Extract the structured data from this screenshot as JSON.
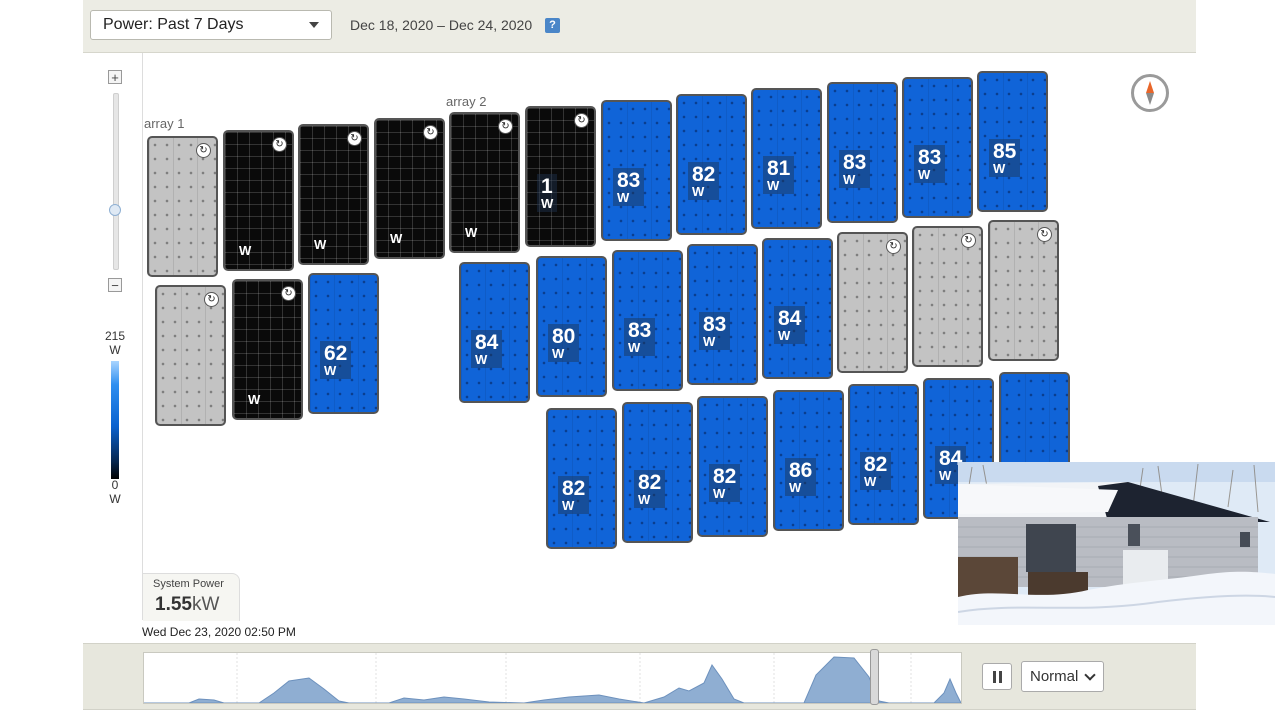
{
  "header": {
    "range_select": "Power: Past 7 Days",
    "date_range": "Dec 18, 2020 – Dec 24, 2020",
    "help_icon": "?"
  },
  "zoom": {
    "plus": "+",
    "minus": "−",
    "level": 0.55
  },
  "legend": {
    "max_value": "215",
    "max_unit": "W",
    "min_value": "0",
    "min_unit": "W"
  },
  "arrays": {
    "array1_label": "array 1",
    "array2_label": "array 2"
  },
  "unit": "W",
  "panels": [
    {
      "value": "",
      "state": "gray",
      "comm_icon": true
    },
    {
      "value": "",
      "state": "black",
      "comm_icon": true
    },
    {
      "value": "",
      "state": "black",
      "comm_icon": true
    },
    {
      "value": "",
      "state": "black",
      "comm_icon": true
    },
    {
      "value": "",
      "state": "black",
      "comm_icon": true
    },
    {
      "value": "1",
      "state": "black",
      "comm_icon": true
    },
    {
      "value": "83",
      "state": "blue"
    },
    {
      "value": "82",
      "state": "blue"
    },
    {
      "value": "81",
      "state": "blue"
    },
    {
      "value": "83",
      "state": "blue"
    },
    {
      "value": "83",
      "state": "blue"
    },
    {
      "value": "85",
      "state": "blue"
    },
    {
      "value": "",
      "state": "gray",
      "comm_icon": true
    },
    {
      "value": "",
      "state": "black",
      "comm_icon": true
    },
    {
      "value": "62",
      "state": "blue"
    },
    {
      "value": "84",
      "state": "blue"
    },
    {
      "value": "80",
      "state": "blue"
    },
    {
      "value": "83",
      "state": "blue"
    },
    {
      "value": "83",
      "state": "blue"
    },
    {
      "value": "84",
      "state": "blue"
    },
    {
      "value": "",
      "state": "gray",
      "comm_icon": true
    },
    {
      "value": "",
      "state": "gray",
      "comm_icon": true
    },
    {
      "value": "",
      "state": "gray",
      "comm_icon": true
    },
    {
      "value": "82",
      "state": "blue"
    },
    {
      "value": "82",
      "state": "blue"
    },
    {
      "value": "82",
      "state": "blue"
    },
    {
      "value": "86",
      "state": "blue"
    },
    {
      "value": "82",
      "state": "blue"
    },
    {
      "value": "84",
      "state": "blue"
    },
    {
      "value": "",
      "state": "blue"
    }
  ],
  "system_power": {
    "label": "System Power",
    "value": "1.55",
    "unit": "kW"
  },
  "timestamp": "Wed Dec 23, 2020 02:50 PM",
  "playback": {
    "speed": "Normal",
    "position": 0.89
  },
  "colors": {
    "panel_blue": "#1064d8",
    "accent": "#4a86c8",
    "compass_needle": "#e8662a"
  }
}
